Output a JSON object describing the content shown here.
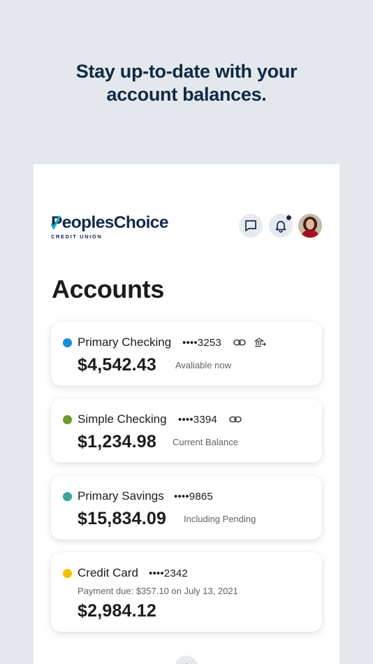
{
  "headline": {
    "line1": "Stay up-to-date with your",
    "line2": "account balances."
  },
  "brand": {
    "name": "PeoplesChoice",
    "subtitle": "CREDIT UNION",
    "navy": "#14284b",
    "accent": "#1ab4c8"
  },
  "header": {
    "icons": [
      "chat-bubble-icon",
      "bell-icon",
      "user-avatar"
    ],
    "has_notification": true
  },
  "page_title": "Accounts",
  "accounts": [
    {
      "name": "Primary Checking",
      "number": "••••3253",
      "balance": "$4,542.43",
      "balance_note": "Avaliable now",
      "dot_color": "#1a8fd0",
      "icons": [
        "link-icon",
        "bank-transfer-icon"
      ]
    },
    {
      "name": "Simple Checking",
      "number": "••••3394",
      "balance": "$1,234.98",
      "balance_note": "Current Balance",
      "dot_color": "#6e9a2e",
      "icons": [
        "link-icon"
      ]
    },
    {
      "name": "Primary Savings",
      "number": "••••9865",
      "balance": "$15,834.09",
      "balance_note": "Including Pending",
      "dot_color": "#3aa39c"
    },
    {
      "name": "Credit Card",
      "number": "••••2342",
      "payment_due": "Payment due: $357.10 on July 13, 2021",
      "balance": "$2,984.12",
      "dot_color": "#f2c200"
    }
  ],
  "add_button_icon": "plus-icon"
}
